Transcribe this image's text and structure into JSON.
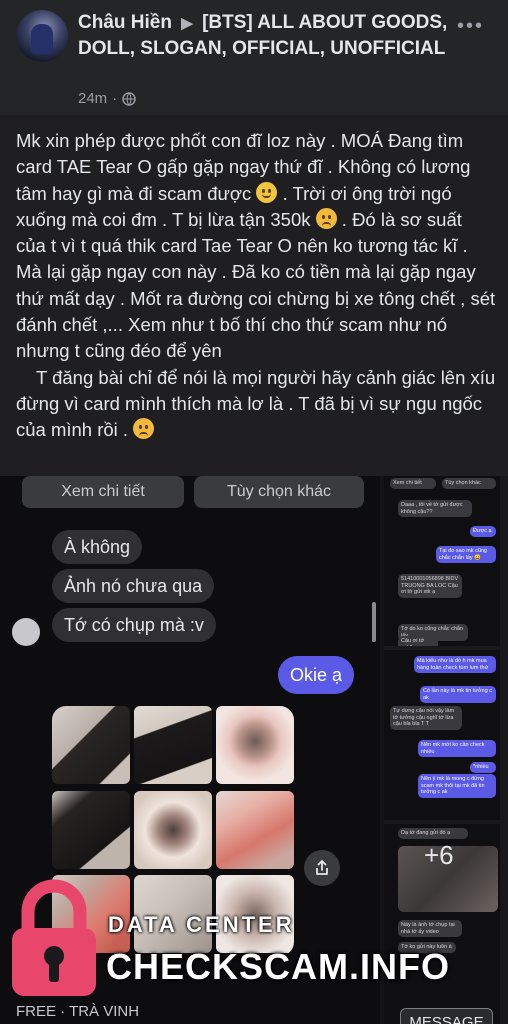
{
  "post": {
    "author": "Châu Hiền",
    "group": "[BTS] ALL ABOUT GOODS, DOLL, SLOGAN, OFFICIAL, UNOFFICIAL",
    "time": "24m",
    "more_label": "•••",
    "body": {
      "line1": "Mk xin phép được phốt con đĩ loz này . MOÁ Đang tìm card TAE Tear O gấp gặp ngay thứ đĩ . Không có lương tâm hay gì mà đi scam được",
      "line2": ". Trời ơi ông trời ngó xuống mà coi đm . T bị lừa tận 350k",
      "line3": ". Đó là sơ suất của t vì t quá thik card Tae Tear O nên ko tương tác kĩ . Mà lại gặp ngay con này . Đã ko có tiền mà lại gặp ngay thứ mất dạy . Mốt ra đường coi chừng bị xe tông chết , sét đánh chết ,... Xem như t bố thí cho thứ scam như nó nhưng t cũng đéo để yên",
      "line4": "T đăng bài chỉ để nói là mọi người hãy cảnh giác lên xíu đừng vì card mình thích mà lơ là . T đã bị vì sự ngu ngốc của mình rồi ."
    }
  },
  "chat_left": {
    "btn_details": "Xem chi tiết",
    "btn_more": "Tùy chọn khác",
    "messages": [
      "À không",
      "Ảnh nó chưa qua",
      "Tớ có chụp mà :v"
    ],
    "my_reply": "Okie ạ"
  },
  "chat_right": {
    "btn1": "Xem chi tiết",
    "btn2": "Tùy chọn khác",
    "p1": [
      "Daaa , tôi về tớ gửi được không cậu??",
      "Được ạ",
      "Tại do sao mk cũng chắc chắn lấy 😀",
      "51410001056898 BIDV TRUONG BA LOC Cậu ơi tớ gửi stk ạ",
      "Tớ do ko cũng chắc chắn lấy",
      "Cậu ơi tớ nghĩ"
    ],
    "p2": [
      "Mà kiểu như là đồ h mk mua hàng toàn check tùm lum thứ",
      "Có lần này là mk tin tưởng c ak",
      "Tự dưng cậu nói vậy làm tớ tưởng cậu nghĩ tớ lừa cậu bla bla T T",
      "Nên mk mới ko cần check nhiều",
      "*nhiều",
      "Nên ý mk là mong c đừng scam mk thôi tại mk đã tin tưởng c ak"
    ],
    "p3": [
      "Dạ tớ đang gửi đó ạ",
      "Này là ảnh tớ chụp tại nhà tớ ấy video",
      "Tớ ko gửi này luôn á"
    ],
    "plus_count": "+6"
  },
  "watermark": {
    "top": "DATA CENTER",
    "main": "CHECKSCAM.INFO"
  },
  "footer": {
    "listing": "FREE · TRÀ VINH",
    "message_button": "MESSAGE"
  }
}
